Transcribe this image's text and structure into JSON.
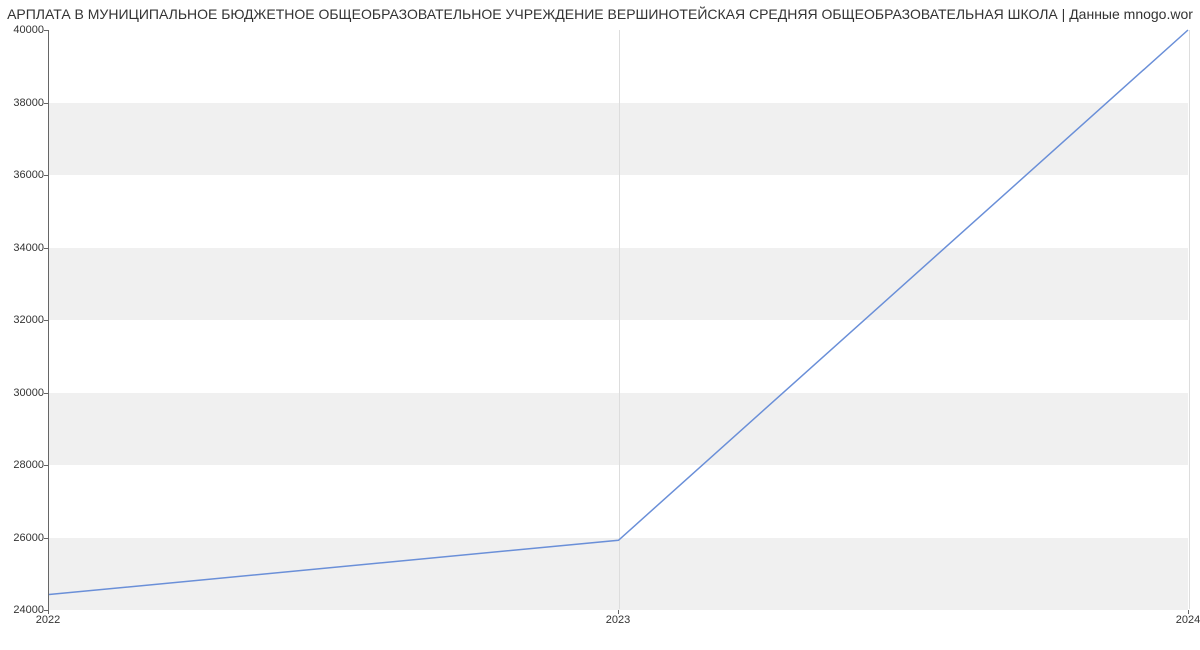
{
  "chart_data": {
    "type": "line",
    "title": "АРПЛАТА В МУНИЦИПАЛЬНОЕ БЮДЖЕТНОЕ ОБЩЕОБРАЗОВАТЕЛЬНОЕ УЧРЕЖДЕНИЕ ВЕРШИНОТЕЙСКАЯ СРЕДНЯЯ ОБЩЕОБРАЗОВАТЕЛЬНАЯ ШКОЛА | Данные mnogo.wor",
    "x": [
      2022,
      2023,
      2024
    ],
    "values": [
      24400,
      25900,
      40000
    ],
    "xlabel": "",
    "ylabel": "",
    "xlim": [
      2022,
      2024
    ],
    "ylim": [
      24000,
      40000
    ],
    "x_ticks": [
      2022,
      2023,
      2024
    ],
    "y_ticks": [
      24000,
      26000,
      28000,
      30000,
      32000,
      34000,
      36000,
      38000,
      40000
    ],
    "line_color": "#6a8fd8",
    "band_color": "#f0f0f0"
  }
}
